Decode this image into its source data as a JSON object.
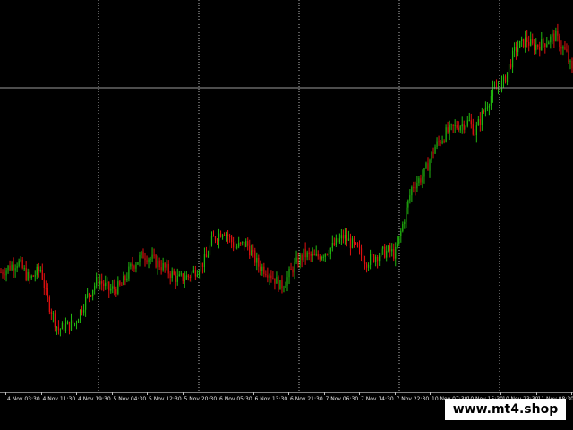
{
  "colors": {
    "background": "#000000",
    "bull": "#22b80f",
    "bear": "#e01010",
    "grid": "#ffffff",
    "crosshair": "#9a9a9a",
    "axis_text": "#e6e6e6",
    "watermark_bg": "#ffffff",
    "watermark_fg": "#000000"
  },
  "watermark": "www.mt4.shop",
  "time_axis": {
    "labels": [
      "4 Nov 03:30",
      "4 Nov 11:30",
      "4 Nov 19:30",
      "5 Nov 04:30",
      "5 Nov 12:30",
      "5 Nov 20:30",
      "6 Nov 05:30",
      "6 Nov 13:30",
      "6 Nov 21:30",
      "7 Nov 06:30",
      "7 Nov 14:30",
      "7 Nov 22:30",
      "10 Nov 07:30",
      "10 Nov 15:30",
      "10 Nov 23:30",
      "11 Nov 08:30",
      "11"
    ]
  },
  "chart_data": {
    "type": "candlestick",
    "price_path": [
      [
        0,
        0.31
      ],
      [
        0.03,
        0.34
      ],
      [
        0.05,
        0.29
      ],
      [
        0.07,
        0.32
      ],
      [
        0.08,
        0.24
      ],
      [
        0.1,
        0.15
      ],
      [
        0.13,
        0.17
      ],
      [
        0.15,
        0.24
      ],
      [
        0.17,
        0.29
      ],
      [
        0.19,
        0.26
      ],
      [
        0.21,
        0.27
      ],
      [
        0.23,
        0.33
      ],
      [
        0.25,
        0.36
      ],
      [
        0.28,
        0.33
      ],
      [
        0.31,
        0.29
      ],
      [
        0.33,
        0.3
      ],
      [
        0.35,
        0.33
      ],
      [
        0.36,
        0.35
      ],
      [
        0.37,
        0.4
      ],
      [
        0.39,
        0.43
      ],
      [
        0.41,
        0.38
      ],
      [
        0.43,
        0.39
      ],
      [
        0.45,
        0.33
      ],
      [
        0.47,
        0.31
      ],
      [
        0.49,
        0.27
      ],
      [
        0.5,
        0.29
      ],
      [
        0.51,
        0.32
      ],
      [
        0.53,
        0.36
      ],
      [
        0.55,
        0.35
      ],
      [
        0.58,
        0.38
      ],
      [
        0.6,
        0.41
      ],
      [
        0.62,
        0.38
      ],
      [
        0.64,
        0.34
      ],
      [
        0.66,
        0.36
      ],
      [
        0.68,
        0.37
      ],
      [
        0.69,
        0.36
      ],
      [
        0.7,
        0.42
      ],
      [
        0.72,
        0.55
      ],
      [
        0.74,
        0.58
      ],
      [
        0.76,
        0.66
      ],
      [
        0.78,
        0.7
      ],
      [
        0.8,
        0.72
      ],
      [
        0.82,
        0.73
      ],
      [
        0.83,
        0.7
      ],
      [
        0.84,
        0.74
      ],
      [
        0.86,
        0.81
      ],
      [
        0.88,
        0.84
      ],
      [
        0.9,
        0.93
      ],
      [
        0.92,
        0.96
      ],
      [
        0.93,
        0.94
      ],
      [
        0.95,
        0.95
      ],
      [
        0.97,
        0.97
      ],
      [
        0.99,
        0.92
      ],
      [
        1,
        0.87
      ]
    ]
  }
}
